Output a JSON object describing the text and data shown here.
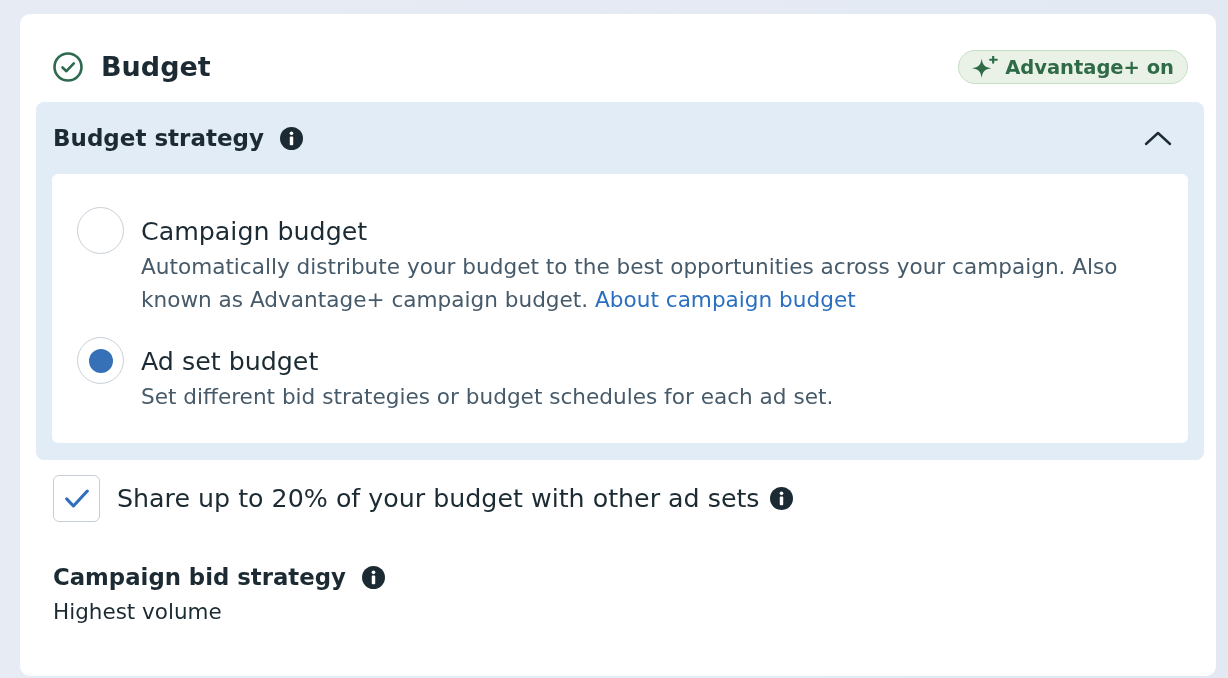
{
  "section": {
    "title": "Budget",
    "complete": true,
    "badge": {
      "label": "Advantage+ on"
    }
  },
  "budget_strategy": {
    "title": "Budget strategy",
    "expanded": true,
    "options": [
      {
        "label": "Campaign budget",
        "description": "Automatically distribute your budget to the best opportunities across your campaign. Also known as Advantage+ campaign budget.",
        "link": "About campaign budget",
        "selected": false
      },
      {
        "label": "Ad set budget",
        "description": "Set different bid strategies or budget schedules for each ad set.",
        "selected": true
      }
    ]
  },
  "share_budget": {
    "label": "Share up to 20% of your budget with other ad sets",
    "checked": true
  },
  "bid_strategy": {
    "title": "Campaign bid strategy",
    "value": "Highest volume"
  }
}
